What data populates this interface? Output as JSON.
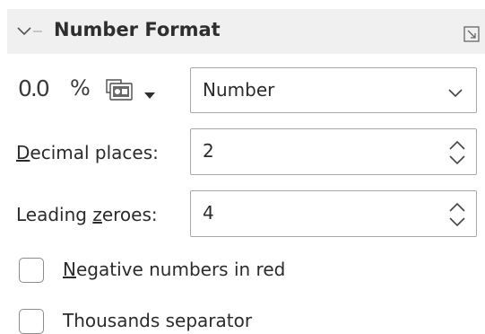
{
  "panel": {
    "title": "Number Format"
  },
  "toolbar": {
    "decimal_icon_text": "0.0",
    "percent_icon_text": "%",
    "category_select": {
      "selected": "Number"
    }
  },
  "fields": {
    "decimal_places": {
      "label_prefix": "",
      "mnemonic": "D",
      "label_rest": "ecimal places:",
      "value": "2"
    },
    "leading_zeroes": {
      "label_prefix": "Leading ",
      "mnemonic": "z",
      "label_rest": "eroes:",
      "value": "4"
    }
  },
  "options": {
    "negative_red": {
      "mnemonic": "N",
      "label_rest": "egative numbers in red",
      "checked": false
    },
    "thousands_separator": {
      "label": "Thousands separator",
      "checked": false
    }
  },
  "icons": {
    "collapse": "chevron-down-icon",
    "more_options": "more-options-icon",
    "currency": "currency-icon",
    "dropdown": "chevron-down-icon",
    "spinner": "spin-arrows-icon"
  },
  "colors": {
    "header_bg": "#f0f0f0",
    "border": "#a8a8a8",
    "text": "#2b2b2b"
  }
}
